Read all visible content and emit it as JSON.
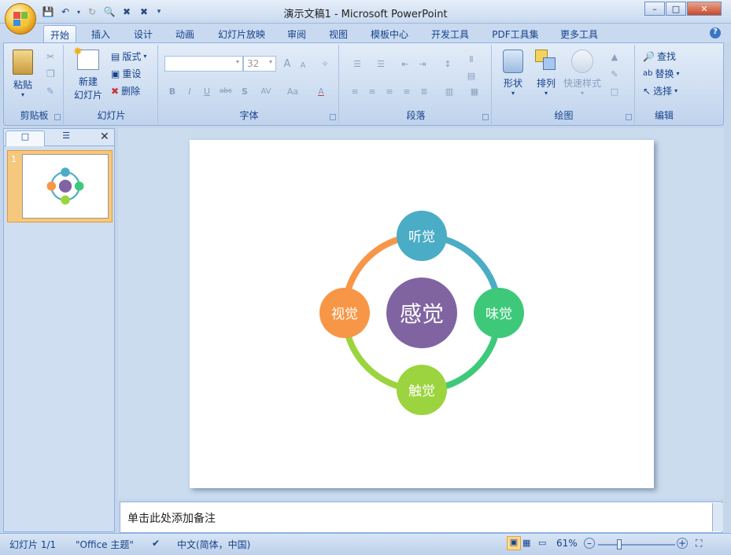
{
  "window": {
    "title": "演示文稿1 - Microsoft PowerPoint"
  },
  "tabs": [
    "开始",
    "插入",
    "设计",
    "动画",
    "幻灯片放映",
    "审阅",
    "视图",
    "模板中心",
    "开发工具",
    "PDF工具集",
    "更多工具"
  ],
  "clipboard": {
    "paste": "粘贴",
    "label": "剪贴板"
  },
  "slides_group": {
    "new_slide": "新建",
    "new_slide2": "幻灯片",
    "layout": "版式",
    "reset": "重设",
    "delete": "删除",
    "label": "幻灯片"
  },
  "font_group": {
    "font_size": "32",
    "bold": "B",
    "italic": "I",
    "underline": "U",
    "strike": "abc",
    "shadow": "S",
    "spacing": "AV",
    "case": "Aa",
    "color": "A",
    "grow": "A",
    "shrink": "A",
    "label": "字体"
  },
  "para_group": {
    "label": "段落"
  },
  "draw_group": {
    "shape": "形状",
    "arrange": "排列",
    "quick": "快速样式",
    "label": "绘图"
  },
  "edit_group": {
    "find": "查找",
    "replace": "替换",
    "select": "选择",
    "label": "编辑"
  },
  "thumbnail": {
    "number": "1"
  },
  "diagram": {
    "center": "感觉",
    "top": "听觉",
    "right": "味觉",
    "bottom": "触觉",
    "left": "视觉",
    "colors": {
      "center": "#8064a2",
      "top": "#4bacc6",
      "right": "#3ec97a",
      "bottom": "#9bd43e",
      "left": "#f79646"
    }
  },
  "notes": {
    "placeholder": "单击此处添加备注"
  },
  "status": {
    "slide": "幻灯片 1/1",
    "theme": "\"Office 主题\"",
    "lang": "中文(简体，中国)",
    "zoom": "61%"
  }
}
